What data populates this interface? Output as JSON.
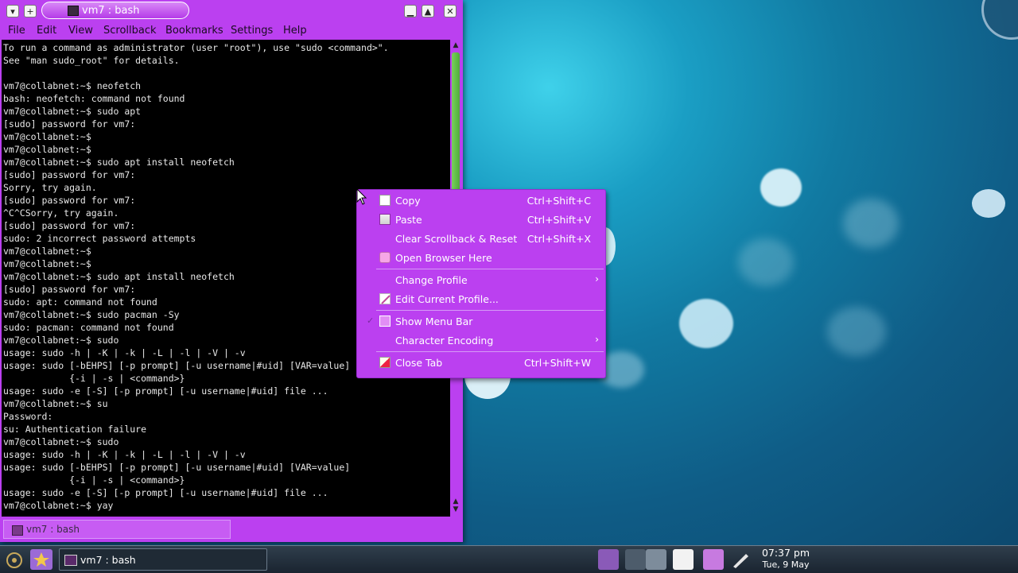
{
  "window": {
    "title": "vm7 : bash",
    "controls": [
      "minimize",
      "maximize",
      "close"
    ]
  },
  "menubar": [
    "File",
    "Edit",
    "View",
    "Scrollback",
    "Bookmarks",
    "Settings",
    "Help"
  ],
  "terminal": {
    "lines": [
      "To run a command as administrator (user \"root\"), use \"sudo <command>\".",
      "See \"man sudo_root\" for details.",
      "",
      "vm7@collabnet:~$ neofetch",
      "bash: neofetch: command not found",
      "vm7@collabnet:~$ sudo apt",
      "[sudo] password for vm7:",
      "vm7@collabnet:~$",
      "vm7@collabnet:~$",
      "vm7@collabnet:~$ sudo apt install neofetch",
      "[sudo] password for vm7:",
      "Sorry, try again.",
      "[sudo] password for vm7:",
      "^C^CSorry, try again.",
      "[sudo] password for vm7:",
      "sudo: 2 incorrect password attempts",
      "vm7@collabnet:~$",
      "vm7@collabnet:~$",
      "vm7@collabnet:~$ sudo apt install neofetch",
      "[sudo] password for vm7:",
      "sudo: apt: command not found",
      "vm7@collabnet:~$ sudo pacman -Sy",
      "sudo: pacman: command not found",
      "vm7@collabnet:~$ sudo",
      "usage: sudo -h | -K | -k | -L | -l | -V | -v",
      "usage: sudo [-bEHPS] [-p prompt] [-u username|#uid] [VAR=value]",
      "            {-i | -s | <command>}",
      "usage: sudo -e [-S] [-p prompt] [-u username|#uid] file ...",
      "vm7@collabnet:~$ su",
      "Password:",
      "su: Authentication failure",
      "vm7@collabnet:~$ sudo",
      "usage: sudo -h | -K | -k | -L | -l | -V | -v",
      "usage: sudo [-bEHPS] [-p prompt] [-u username|#uid] [VAR=value]",
      "            {-i | -s | <command>}",
      "usage: sudo -e [-S] [-p prompt] [-u username|#uid] file ...",
      "vm7@collabnet:~$ yay"
    ]
  },
  "tab": {
    "label": "vm7 : bash"
  },
  "context_menu": {
    "copy": {
      "label": "Copy",
      "shortcut": "Ctrl+Shift+C"
    },
    "paste": {
      "label": "Paste",
      "shortcut": "Ctrl+Shift+V"
    },
    "clear": {
      "label": "Clear Scrollback & Reset",
      "shortcut": "Ctrl+Shift+X"
    },
    "browser": {
      "label": "Open Browser Here"
    },
    "change_profile": {
      "label": "Change Profile"
    },
    "edit_profile": {
      "label": "Edit Current Profile..."
    },
    "show_menu_bar": {
      "label": "Show Menu Bar"
    },
    "encoding": {
      "label": "Character Encoding"
    },
    "close_tab": {
      "label": "Close Tab",
      "shortcut": "Ctrl+Shift+W"
    }
  },
  "taskbar": {
    "task_label": "vm7 : bash",
    "clock_time": "07:37 pm",
    "clock_date": "Tue, 9 May"
  },
  "colors": {
    "window_accent": "#bb40f0",
    "terminal_bg": "#000000",
    "scroll_thumb": "#5fbf45"
  }
}
